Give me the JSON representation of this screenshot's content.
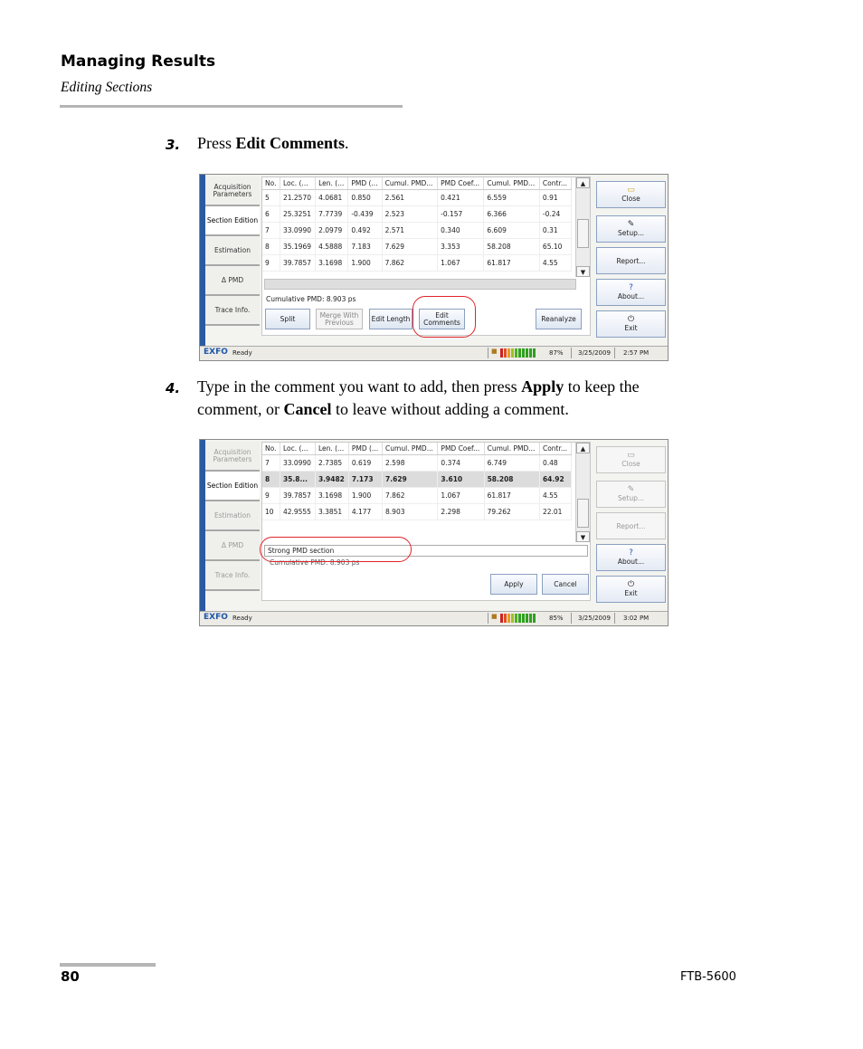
{
  "header": {
    "title": "Managing Results",
    "subtitle": "Editing Sections"
  },
  "steps": [
    {
      "number": "3.",
      "parts": [
        "Press ",
        "Edit Comments",
        "."
      ]
    },
    {
      "number": "4.",
      "line1": [
        "Type in the comment you want to add, then press ",
        "Apply",
        " to keep the"
      ],
      "line2": [
        "comment, or ",
        "Cancel",
        " to leave without adding a comment."
      ]
    }
  ],
  "screen1": {
    "tabs": [
      "Acquisition Parameters",
      "Section Edition",
      "Estimation",
      "Δ PMD",
      "Trace Info."
    ],
    "columns": [
      "No.",
      "Loc. (...",
      "Len. (...",
      "PMD (...",
      "Cumul. PMD...",
      "PMD Coef...",
      "Cumul. PMD...",
      "Contr..."
    ],
    "rows": [
      [
        "5",
        "21.2570",
        "4.0681",
        "0.850",
        "2.561",
        "0.421",
        "6.559",
        "0.91"
      ],
      [
        "6",
        "25.3251",
        "7.7739",
        "-0.439",
        "2.523",
        "-0.157",
        "6.366",
        "-0.24"
      ],
      [
        "7",
        "33.0990",
        "2.0979",
        "0.492",
        "2.571",
        "0.340",
        "6.609",
        "0.31"
      ],
      [
        "8",
        "35.1969",
        "4.5888",
        "7.183",
        "7.629",
        "3.353",
        "58.208",
        "65.10"
      ],
      [
        "9",
        "39.7857",
        "3.1698",
        "1.900",
        "7.862",
        "1.067",
        "61.817",
        "4.55"
      ]
    ],
    "cumulative": "Cumulative PMD: 8.903 ps",
    "buttons": {
      "split": "Split",
      "merge": "Merge With Previous",
      "edit_length": "Edit Length",
      "edit_comments": "Edit Comments",
      "reanalyze": "Reanalyze"
    },
    "side": {
      "close": "Close",
      "setup": "Setup...",
      "report": "Report...",
      "about": "About...",
      "exit": "Exit"
    },
    "status": {
      "brand": "EXFO",
      "state": "Ready",
      "battery": "87%",
      "date": "3/25/2009",
      "time": "2:57 PM"
    }
  },
  "screen2": {
    "tabs": [
      "Acquisition Parameters",
      "Section Edition",
      "Estimation",
      "Δ PMD",
      "Trace Info."
    ],
    "columns": [
      "No.",
      "Loc. (...",
      "Len. (...",
      "PMD (...",
      "Cumul. PMD...",
      "PMD Coef...",
      "Cumul. PMD...",
      "Contr..."
    ],
    "rows": [
      [
        "7",
        "33.0990",
        "2.7385",
        "0.619",
        "2.598",
        "0.374",
        "6.749",
        "0.48"
      ],
      [
        "8",
        "35.8...",
        "3.9482",
        "7.173",
        "7.629",
        "3.610",
        "58.208",
        "64.92"
      ],
      [
        "9",
        "39.7857",
        "3.1698",
        "1.900",
        "7.862",
        "1.067",
        "61.817",
        "4.55"
      ],
      [
        "10",
        "42.9555",
        "3.3851",
        "4.177",
        "8.903",
        "2.298",
        "79.262",
        "22.01"
      ]
    ],
    "selected_row": 1,
    "comment": "Strong PMD section",
    "cumulative": "Cumulative PMD: 8.903 ps",
    "buttons": {
      "apply": "Apply",
      "cancel": "Cancel"
    },
    "side": {
      "close": "Close",
      "setup": "Setup...",
      "report": "Report...",
      "about": "About...",
      "exit": "Exit"
    },
    "status": {
      "brand": "EXFO",
      "state": "Ready",
      "battery": "85%",
      "date": "3/25/2009",
      "time": "3:02 PM"
    }
  },
  "footer": {
    "page": "80",
    "product": "FTB-5600"
  }
}
